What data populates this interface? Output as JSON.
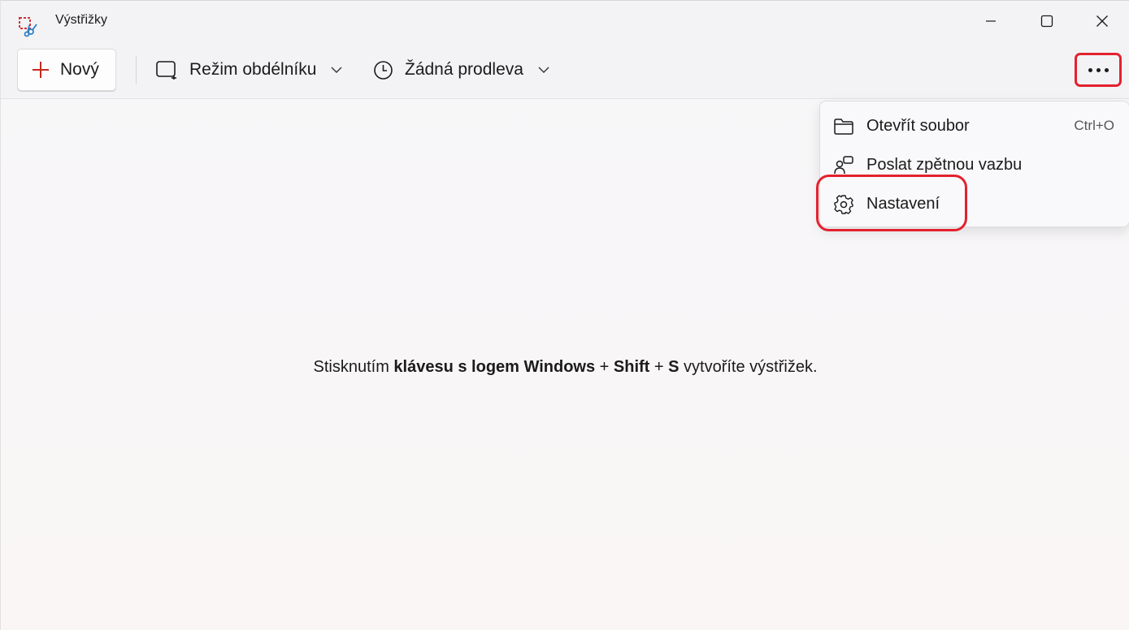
{
  "window": {
    "title": "Výstřižky",
    "icon": "snipping-tool-icon"
  },
  "toolbar": {
    "new_label": "Nový",
    "mode_label": "Režim obdélníku",
    "delay_label": "Žádná prodleva",
    "more_icon": "more-icon"
  },
  "menu": {
    "items": [
      {
        "label": "Otevřít soubor",
        "shortcut": "Ctrl+O",
        "icon": "folder-icon"
      },
      {
        "label": "Poslat zpětnou vazbu",
        "shortcut": "",
        "icon": "feedback-icon"
      },
      {
        "label": "Nastavení",
        "shortcut": "",
        "icon": "gear-icon"
      }
    ]
  },
  "hint": {
    "prefix": "Stisknutím ",
    "keys": "klávesu s logem Windows",
    "plus1": " + ",
    "shift": "Shift",
    "plus2": " + ",
    "s": "S",
    "suffix": " vytvoříte výstřižek."
  },
  "colors": {
    "accent_red": "#e3212e",
    "new_plus": "#c42b1c"
  }
}
